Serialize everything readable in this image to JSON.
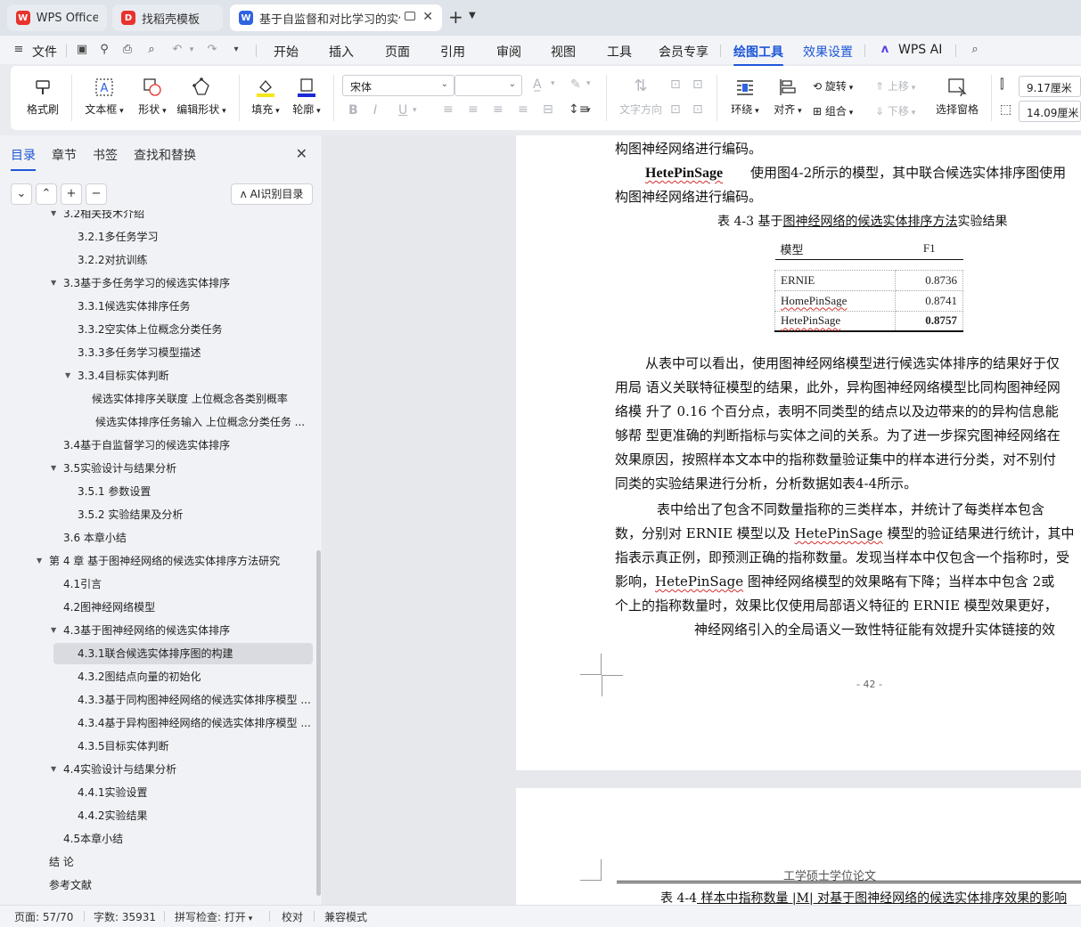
{
  "tabs": [
    {
      "label": "WPS Office",
      "logo_color": "#e8322d"
    },
    {
      "label": "找稻壳模板",
      "logo_color": "#e8322d"
    },
    {
      "label": "基于自监督和对比学习的实体",
      "logo_color": "#2f63e0",
      "active": true
    }
  ],
  "menu": {
    "file": "文件",
    "items": [
      "开始",
      "插入",
      "页面",
      "引用",
      "审阅",
      "视图",
      "工具",
      "会员专享",
      "绘图工具",
      "效果设置",
      "WPS AI"
    ],
    "active": "绘图工具"
  },
  "ribbon": {
    "format_painter": "格式刷",
    "textbox": "文本框",
    "shape": "形状",
    "edit_shape": "编辑形状",
    "fill": "填充",
    "outline": "轮廓",
    "font_name": "宋体",
    "font_size": "",
    "text_direction": "文字方向",
    "wrap": "环绕",
    "align": "对齐",
    "rotate": "旋转",
    "group": "组合",
    "bring_up": "上移",
    "send_down": "下移",
    "selection_pane": "选择窗格",
    "height": "9.17厘米",
    "width": "14.09厘米",
    "fill_color": "#f5e61a",
    "outline_color": "#1a2ad6"
  },
  "nav": {
    "tabs": [
      "目录",
      "章节",
      "书签",
      "查找和替换"
    ],
    "active_tab": "目录",
    "ai_toc": "AI识别目录",
    "toc": [
      {
        "label": "3.2相关技术介绍",
        "level": 2,
        "arrow": true,
        "clipped": true
      },
      {
        "label": "3.2.1多任务学习",
        "level": 3
      },
      {
        "label": "3.2.2对抗训练",
        "level": 3
      },
      {
        "label": "3.3基于多任务学习的候选实体排序",
        "level": 2,
        "arrow": true
      },
      {
        "label": "3.3.1候选实体排序任务",
        "level": 3
      },
      {
        "label": "3.3.2空实体上位概念分类任务",
        "level": 3
      },
      {
        "label": "3.3.3多任务学习模型描述",
        "level": 3
      },
      {
        "label": "3.3.4目标实体判断",
        "level": 3,
        "arrow": true
      },
      {
        "label": "候选实体排序关联度 上位概念各类别概率",
        "level": 4
      },
      {
        "label": "候选实体排序任务输入 上位概念分类任务 ...",
        "level": 4,
        "indent_extra": 4
      },
      {
        "label": "3.4基于自监督学习的候选实体排序",
        "level": 2
      },
      {
        "label": "3.5实验设计与结果分析",
        "level": 2,
        "arrow": true
      },
      {
        "label": "3.5.1 参数设置",
        "level": 3
      },
      {
        "label": "3.5.2 实验结果及分析",
        "level": 3
      },
      {
        "label": "3.6 本章小结",
        "level": 2
      },
      {
        "label": "第 4 章 基于图神经网络的候选实体排序方法研究",
        "level": 1,
        "arrow": true
      },
      {
        "label": "4.1引言",
        "level": 2
      },
      {
        "label": "4.2图神经网络模型",
        "level": 2
      },
      {
        "label": "4.3基于图神经网络的候选实体排序",
        "level": 2,
        "arrow": true
      },
      {
        "label": "4.3.1联合候选实体排序图的构建",
        "level": 3,
        "selected": true
      },
      {
        "label": "4.3.2图结点向量的初始化",
        "level": 3
      },
      {
        "label": "4.3.3基于同构图神经网络的候选实体排序模型 ...",
        "level": 3
      },
      {
        "label": "4.3.4基于异构图神经网络的候选实体排序模型 ...",
        "level": 3
      },
      {
        "label": "4.3.5目标实体判断",
        "level": 3
      },
      {
        "label": "4.4实验设计与结果分析",
        "level": 2,
        "arrow": true
      },
      {
        "label": "4.4.1实验设置",
        "level": 3
      },
      {
        "label": "4.4.2实验结果",
        "level": 3
      },
      {
        "label": "4.5本章小结",
        "level": 2
      },
      {
        "label": "结 论",
        "level": 1
      },
      {
        "label": "参考文献",
        "level": 1
      }
    ]
  },
  "doc": {
    "line1": "构图神经网络进行编码。",
    "hete_term": "HetePinSage",
    "hete_rest": "使用图4-2所示的模型，其中联合候选实体排序图使用",
    "line3": "构图神经网络进行编码。",
    "table_caption_prefix": "表 4-3 基于",
    "table_caption_under": "图神经网络的候选实体排序方法",
    "table_caption_suffix": "实验结果",
    "table": {
      "headers": [
        "模型",
        "F1"
      ],
      "rows": [
        [
          "ERNIE",
          "0.8736"
        ],
        [
          "HomePinSage",
          "0.8741"
        ],
        [
          "HetePinSage",
          "0.8757"
        ]
      ]
    },
    "para1": [
      "从表中可以看出，使用图神经网络模型进行候选实体排序的结果好于仅",
      "用局 语义关联特征模型的结果，此外，异构图神经网络模型比同构图神经网",
      "络模 升了  0.16 个百分点，表明不同类型的结点以及边带来的的异构信息能",
      "够帮 型更准确的判断指标与实体之间的关系。为了进一步探究图神经网络在",
      "效果原因，按照样本文本中的指称数量验证集中的样本进行分类，对不别付",
      "同类的实验结果进行分析，分析数据如表4-4所示。"
    ],
    "para2_l1": "表中给出了包含不同数量指称的三类样本，并统计了每类样本包含",
    "para2_l2_a": "数，分别对  ERNIE 模型以及  ",
    "para2_l2_b": "HetePinSage",
    "para2_l2_c": " 模型的验证结果进行统计，其中",
    "para2_l3": "指表示真正例，即预测正确的指称数量。发现当样本中仅包含一个指称时，受",
    "para2_l4_a": "影响，",
    "para2_l4_b": "HetePinSage",
    "para2_l4_c": " 图神经网络模型的效果略有下降；当样本中包含  2或",
    "para2_l5": "个上的指称数量时，效果比仅使用局部语义特征的  ERNIE 模型效果更好，",
    "para2_l6": "神经网络引入的全局语义一致性特征能有效提升实体链接的效",
    "page_number": "- 42 -",
    "header2": "工学硕士学位论文",
    "caption2_prefix": "表 4-4",
    "caption2_under": " 样本中指称数量  |M| 对基于图神经网络的候选实体排序效果的影响"
  },
  "status": {
    "page": "页面: 57/70",
    "words": "字数: 35931",
    "spell": "拼写检查: 打开",
    "proof": "校对",
    "compat": "兼容模式"
  }
}
